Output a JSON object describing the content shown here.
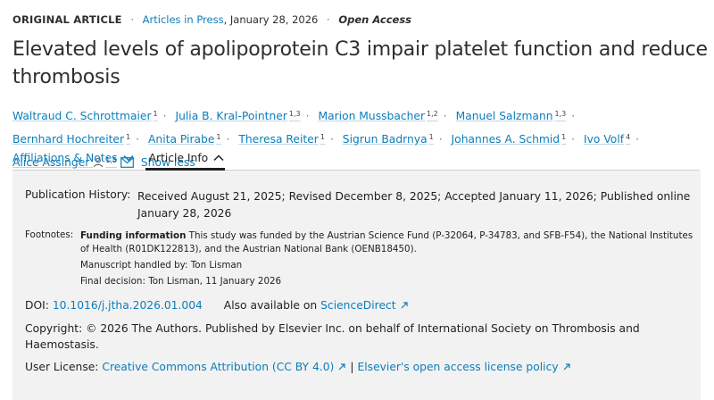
{
  "header": {
    "article_type": "ORIGINAL ARTICLE",
    "articles_in_press": "Articles in Press",
    "date": ", January 28, 2026",
    "access": "Open Access"
  },
  "title": "Elevated levels of apolipoprotein C3 impair platelet function and reduce thrombosis",
  "authors": [
    {
      "name": "Waltraud C. Schrottmaier",
      "aff": "1"
    },
    {
      "name": "Julia B. Kral-Pointner",
      "aff": "1,3"
    },
    {
      "name": "Marion Mussbacher",
      "aff": "1,2"
    },
    {
      "name": "Manuel Salzmann",
      "aff": "1,3"
    },
    {
      "name": "Bernhard Hochreiter",
      "aff": "1"
    },
    {
      "name": "Anita Pirabe",
      "aff": "1"
    },
    {
      "name": "Theresa Reiter",
      "aff": "1"
    },
    {
      "name": "Sigrun Badrnya",
      "aff": "1"
    },
    {
      "name": "Johannes A. Schmid",
      "aff": "1"
    },
    {
      "name": "Ivo Volf",
      "aff": "4"
    },
    {
      "name": "Alice Assinger",
      "aff": "1,5"
    }
  ],
  "show_less": "Show less",
  "tabs": {
    "affiliations": "Affiliations & Notes",
    "article_info": "Article Info"
  },
  "info": {
    "pub_history_label": "Publication History:",
    "pub_history": "Received August 21, 2025; Revised December 8, 2025; Accepted January 11, 2026; Published online January 28, 2026",
    "footnotes_label": "Footnotes:",
    "funding_label": "Funding information",
    "funding_text": " This study was funded by the Austrian Science Fund (P-32064, P-34783, and SFB-F54), the National Institutes of Health (R01DK122813), and the Austrian National Bank (OENB18450).",
    "handled_by": "Manuscript handled by: Ton Lisman",
    "final_decision": "Final decision: Ton Lisman, 11 January 2026",
    "doi_label": "DOI:",
    "doi": "10.1016/j.jtha.2026.01.004",
    "also_label": "Also available on",
    "also_link": "ScienceDirect",
    "copyright": "Copyright: © 2026 The Authors. Published by Elsevier Inc. on behalf of International Society on Thrombosis and Haemostasis.",
    "license_label": "User License:",
    "license_link": "Creative Commons Attribution (CC BY 4.0)",
    "policy_link": "Elsevier's open access license policy"
  },
  "icons": {
    "person": "person-icon",
    "mail": "mail-icon",
    "chevron": "chevron-up-icon",
    "external": "external-link-icon"
  },
  "colors": {
    "link": "#0c7dbb",
    "panel": "#f2f2f2"
  }
}
